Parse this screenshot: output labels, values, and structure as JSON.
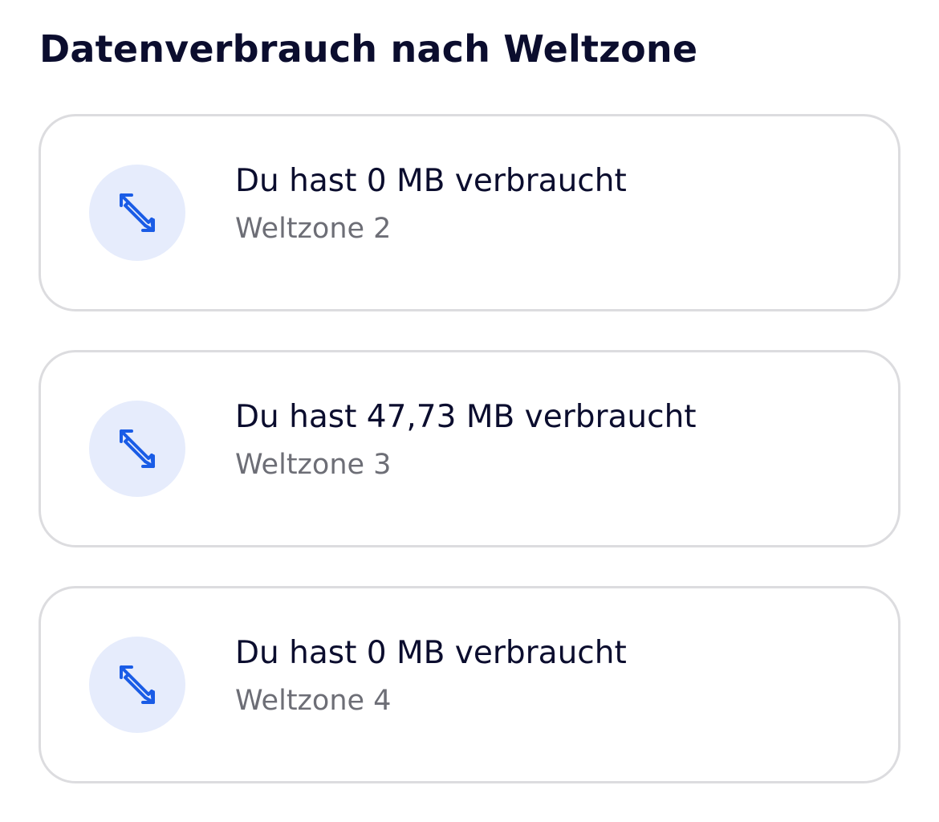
{
  "header": {
    "title": "Datenverbrauch nach Weltzone"
  },
  "zones": [
    {
      "usage_text": "Du hast 0 MB verbraucht",
      "zone_label": "Weltzone 2",
      "icon": "data-transfer-arrows-icon"
    },
    {
      "usage_text": "Du hast 47,73 MB verbraucht",
      "zone_label": "Weltzone 3",
      "icon": "data-transfer-arrows-icon"
    },
    {
      "usage_text": "Du hast 0 MB verbraucht",
      "zone_label": "Weltzone 4",
      "icon": "data-transfer-arrows-icon"
    }
  ],
  "colors": {
    "accent": "#1a5ce6",
    "icon_background": "#e6ecfc",
    "card_border": "#dcdcdf",
    "title_text": "#0b0d2e",
    "secondary_text": "#6d6e76"
  }
}
